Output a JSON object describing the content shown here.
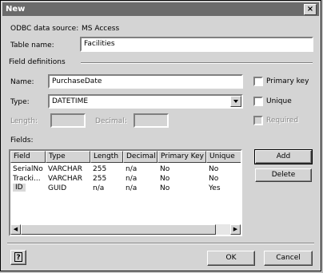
{
  "window": {
    "title": "New",
    "close_glyph": "×"
  },
  "odbc": {
    "label": "ODBC data source:",
    "value": "MS Access"
  },
  "table_name": {
    "label": "Table name:",
    "value": "Facilities"
  },
  "field_definitions": {
    "label": "Field definitions"
  },
  "name": {
    "label": "Name:",
    "value": "PurchaseDate"
  },
  "type": {
    "label": "Type:",
    "value": "DATETIME"
  },
  "length": {
    "label": "Length:"
  },
  "decimal": {
    "label": "Decimal:"
  },
  "checks": {
    "primary_key": "Primary key",
    "unique": "Unique",
    "required": "Required"
  },
  "fields": {
    "label": "Fields:",
    "columns": [
      "Field",
      "Type",
      "Length",
      "Decimal",
      "Primary Key",
      "Unique"
    ],
    "rows": [
      [
        "SerialNo",
        "VARCHAR",
        "255",
        "n/a",
        "No",
        "No"
      ],
      [
        "Tracki...",
        "VARCHAR",
        "255",
        "n/a",
        "No",
        "No"
      ],
      [
        "ID",
        "GUID",
        "n/a",
        "n/a",
        "No",
        "Yes"
      ]
    ]
  },
  "buttons": {
    "add": "Add",
    "delete": "Delete",
    "ok": "OK",
    "cancel": "Cancel",
    "help": "?"
  },
  "icons": {
    "dropdown": "chevron-down-icon",
    "close": "close-icon",
    "help": "help-icon"
  }
}
